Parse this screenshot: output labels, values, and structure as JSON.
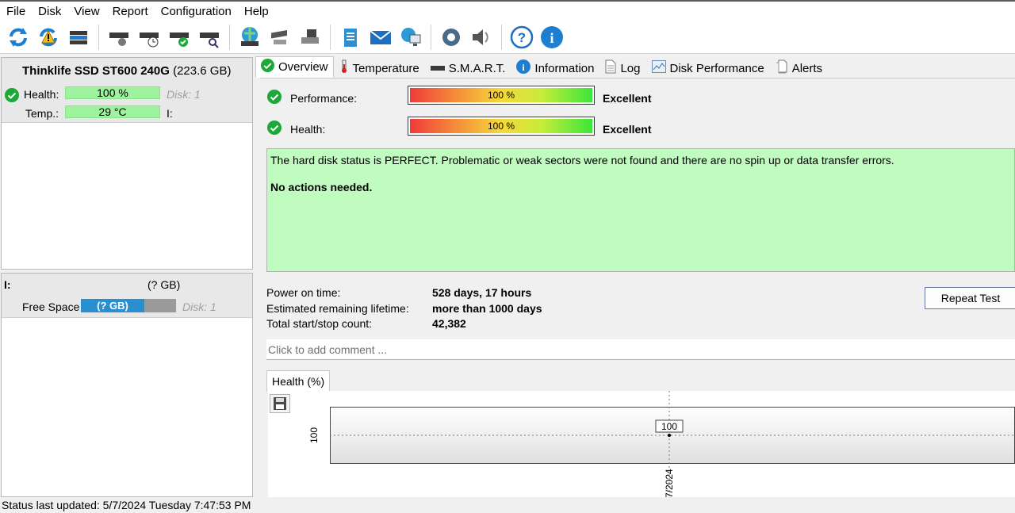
{
  "menu": [
    "File",
    "Disk",
    "View",
    "Report",
    "Configuration",
    "Help"
  ],
  "toolbar": {
    "icons": [
      "refresh-icon",
      "refresh-warning-icon",
      "disk-list-icon",
      "disk-hdd-icon",
      "disk-clock-icon",
      "disk-check-icon",
      "disk-search-icon",
      "globe-disk-icon",
      "disk-cog-icon",
      "disk-usb-icon",
      "notepad-icon",
      "mail-icon",
      "network-computer-icon",
      "settings-gear-icon",
      "speaker-icon",
      "help-icon",
      "info-icon"
    ]
  },
  "disk": {
    "name": "Thinklife SSD ST600 240G",
    "size": "(223.6 GB)",
    "health_label": "Health:",
    "health_value": "100 %",
    "disk_num": "Disk: 1",
    "temp_label": "Temp.:",
    "temp_value": "29 °C",
    "drive_letter": "I:"
  },
  "volume": {
    "letter": "I:",
    "size": "(? GB)",
    "free_label": "Free Space",
    "free_value": "(? GB)",
    "disk_num": "Disk: 1"
  },
  "tabs": [
    {
      "label": "Overview",
      "icon": "check-circle-icon"
    },
    {
      "label": "Temperature",
      "icon": "thermometer-icon"
    },
    {
      "label": "S.M.A.R.T.",
      "icon": "drive-icon"
    },
    {
      "label": "Information",
      "icon": "info-icon"
    },
    {
      "label": "Log",
      "icon": "document-icon"
    },
    {
      "label": "Disk Performance",
      "icon": "performance-chart-icon"
    },
    {
      "label": "Alerts",
      "icon": "alerts-icon"
    }
  ],
  "overview": {
    "performance_label": "Performance:",
    "performance_value": "100 %",
    "performance_rating": "Excellent",
    "performance_level": 100,
    "health_label": "Health:",
    "health_value": "100 %",
    "health_rating": "Excellent",
    "health_level": 100,
    "message": "The hard disk status is PERFECT. Problematic or weak sectors were not found and there are no spin up or data transfer errors.",
    "action": "No actions needed.",
    "power_on_label": "Power on time:",
    "power_on_value": "528 days, 17 hours",
    "lifetime_label": "Estimated remaining lifetime:",
    "lifetime_value": "more than 1000 days",
    "startstop_label": "Total start/stop count:",
    "startstop_value": "42,382",
    "repeat_button": "Repeat Test",
    "comment_placeholder": "Click to add comment ..."
  },
  "chart_tab": "Health (%)",
  "chart_data": {
    "type": "line",
    "x": [
      "7/2024"
    ],
    "values": [
      100
    ],
    "ylabel": "100",
    "point_label": "100"
  },
  "status": "Status last updated: 5/7/2024 Tuesday 7:47:53 PM",
  "colors": {
    "bar_green": "#9ef49e",
    "message_bg": "#c0fbc0",
    "accent_blue": "#2a8fd0"
  }
}
